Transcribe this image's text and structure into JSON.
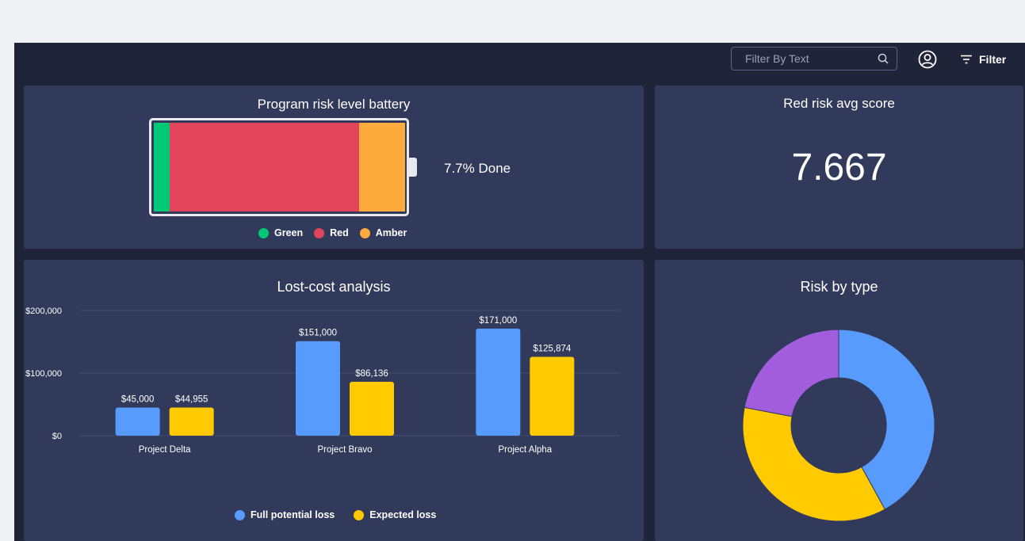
{
  "topbar": {
    "search_placeholder": "Filter By Text",
    "search_value": "",
    "filter_label": "Filter"
  },
  "battery_panel": {
    "title": "Program risk level battery",
    "done_text": "7.7% Done",
    "legend": [
      {
        "label": "Green",
        "color": "#00c875"
      },
      {
        "label": "Red",
        "color": "#e2445c"
      },
      {
        "label": "Amber",
        "color": "#fdab3d"
      }
    ]
  },
  "score_panel": {
    "title": "Red risk avg score",
    "value": "7.667"
  },
  "cost_panel": {
    "title": "Lost-cost analysis",
    "legend": [
      {
        "label": "Full potential loss",
        "color": "#579bfc"
      },
      {
        "label": "Expected loss",
        "color": "#ffcb00"
      }
    ]
  },
  "risk_panel": {
    "title": "Risk by type"
  },
  "chart_data": [
    {
      "type": "bar",
      "title": "Lost-cost analysis",
      "categories": [
        "Project Delta",
        "Project Bravo",
        "Project Alpha"
      ],
      "series": [
        {
          "name": "Full potential loss",
          "color": "#579bfc",
          "values": [
            45000,
            151000,
            171000
          ],
          "labels": [
            "$45,000",
            "$151,000",
            "$171,000"
          ]
        },
        {
          "name": "Expected loss",
          "color": "#ffcb00",
          "values": [
            44955,
            86136,
            125874
          ],
          "labels": [
            "$44,955",
            "$86,136",
            "$125,874"
          ]
        }
      ],
      "ylim": [
        0,
        200000
      ],
      "yticks": [
        "$0",
        "$100,000",
        "$200,000"
      ],
      "grid": true,
      "legend": "bottom"
    },
    {
      "type": "pie",
      "title": "Risk by type",
      "donut": true,
      "slices": [
        {
          "value": 42,
          "color": "#579bfc"
        },
        {
          "value": 36,
          "color": "#ffcb00"
        },
        {
          "value": 22,
          "color": "#a25ddc"
        }
      ]
    }
  ]
}
